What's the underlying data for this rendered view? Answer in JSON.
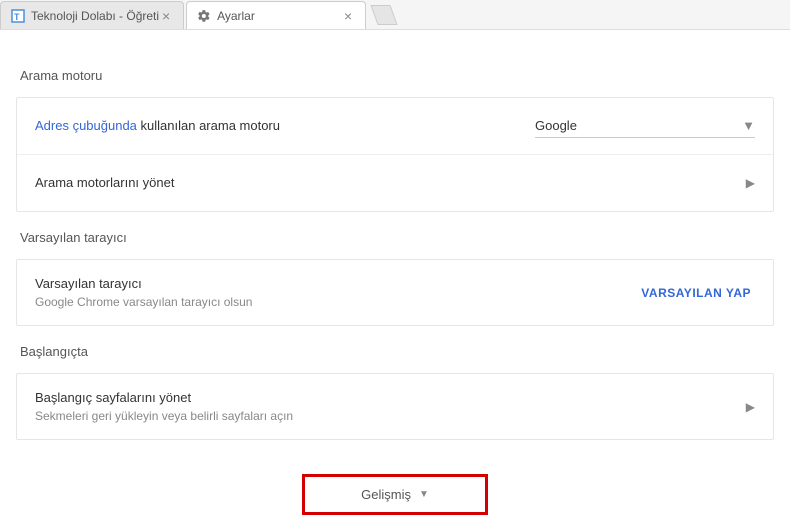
{
  "tabs": [
    {
      "title": "Teknoloji Dolabı - Öğreti",
      "active": false
    },
    {
      "title": "Ayarlar",
      "active": true
    }
  ],
  "sections": {
    "search_engine": {
      "title": "Arama motoru",
      "row1_link": "Adres çubuğunda",
      "row1_rest": " kullanılan arama motoru",
      "row1_select": "Google",
      "row2_label": "Arama motorlarını yönet"
    },
    "default_browser": {
      "title": "Varsayılan tarayıcı",
      "row_label": "Varsayılan tarayıcı",
      "row_sub": "Google Chrome varsayılan tarayıcı olsun",
      "action": "VARSAYILAN YAP"
    },
    "startup": {
      "title": "Başlangıçta",
      "row_label": "Başlangıç sayfalarını yönet",
      "row_sub": "Sekmeleri geri yükleyin veya belirli sayfaları açın"
    }
  },
  "advanced_label": "Gelişmiş"
}
